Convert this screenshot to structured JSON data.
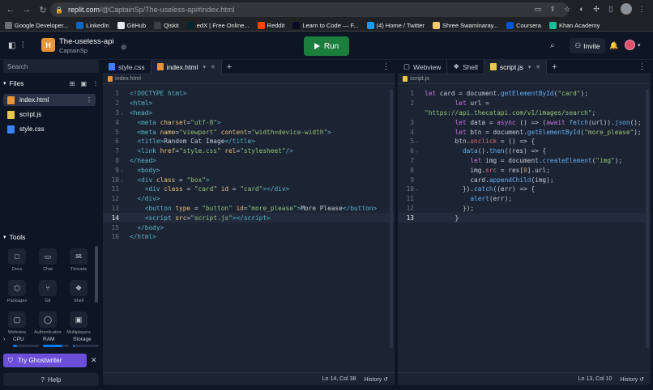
{
  "browser": {
    "url_host": "replit.com",
    "url_path": "/@CaptainSp/The-useless-api#index.html",
    "bookmarks": [
      {
        "label": "Google Developer...",
        "color": "#6d6f73"
      },
      {
        "label": "LinkedIn",
        "color": "#0a66c2"
      },
      {
        "label": "GitHub",
        "color": "#e8eaed"
      },
      {
        "label": "Qiskit",
        "color": "#3c4043"
      },
      {
        "label": "edX | Free Online...",
        "color": "#02262b"
      },
      {
        "label": "Reddit",
        "color": "#ff4500"
      },
      {
        "label": "Learn to Code — F...",
        "color": "#0a0a23"
      },
      {
        "label": "(4) Home / Twitter",
        "color": "#1d9bf0"
      },
      {
        "label": "Shree Swaminaray...",
        "color": "#f3c96b"
      },
      {
        "label": "Coursera",
        "color": "#0056d2"
      },
      {
        "label": "Khan Academy",
        "color": "#14bf96"
      }
    ]
  },
  "header": {
    "repl_name": "The-useless-api",
    "owner": "CaptainSp",
    "run_label": "Run",
    "invite_label": "Invite"
  },
  "sidebar": {
    "search_placeholder": "Search",
    "files_title": "Files",
    "files": [
      {
        "name": "index.html",
        "color": "#e9943a"
      },
      {
        "name": "script.js",
        "color": "#e9c74a"
      },
      {
        "name": "style.css",
        "color": "#3b82f6"
      }
    ],
    "tools_title": "Tools",
    "tools": [
      {
        "label": "Docs",
        "icon": "□"
      },
      {
        "label": "Chat",
        "icon": "▭"
      },
      {
        "label": "Threads",
        "icon": "✉"
      },
      {
        "label": "Packages",
        "icon": "⬡"
      },
      {
        "label": "Git",
        "icon": "⑂"
      },
      {
        "label": "Shell",
        "icon": "❖"
      },
      {
        "label": "Webview",
        "icon": "▢"
      },
      {
        "label": "Authentication",
        "icon": "◯"
      },
      {
        "label": "Multiplayers",
        "icon": "▣"
      }
    ],
    "resources": [
      {
        "label": "CPU",
        "fraction": 0.15
      },
      {
        "label": "RAM",
        "fraction": 0.75
      },
      {
        "label": "Storage",
        "fraction": 0.05
      }
    ],
    "ghost_label": "Try Ghostwriter",
    "help_label": "Help"
  },
  "left_pane": {
    "tabs": [
      "style.css",
      "index.html"
    ],
    "crumb": "index.html",
    "cursor": "Ln 14, Col 38",
    "history": "History",
    "lines": [
      "<span class=\"doc\">&lt;!DOCTYPE html&gt;</span>",
      "<span class=\"tag\">&lt;html&gt;</span>",
      "<span class=\"tag\">&lt;head&gt;</span>",
      "  <span class=\"tag\">&lt;meta</span> <span class=\"attr\">charset</span>=<span class=\"str\">\"utf-8\"</span><span class=\"tag\">&gt;</span>",
      "  <span class=\"tag\">&lt;meta</span> <span class=\"attr\">name</span>=<span class=\"str\">\"viewport\"</span> <span class=\"attr\">content</span>=<span class=\"str\">\"width=device-width\"</span><span class=\"tag\">&gt;</span>",
      "  <span class=\"tag\">&lt;title&gt;</span>Random Cat Image<span class=\"tag\">&lt;/title&gt;</span>",
      "  <span class=\"tag\">&lt;link</span> <span class=\"attr\">href</span>=<span class=\"str\">\"style.css\"</span> <span class=\"attr\">rel</span>=<span class=\"str\">\"stylesheet\"</span><span class=\"tag\">/&gt;</span>",
      "<span class=\"tag\">&lt;/head&gt;</span>",
      "  <span class=\"tag\">&lt;body&gt;</span>",
      "  <span class=\"tag\">&lt;div</span> <span class=\"attr\">class</span> = <span class=\"str\">\"box\"</span><span class=\"tag\">&gt;</span>",
      "    <span class=\"tag\">&lt;div</span> <span class=\"attr\">class</span> = <span class=\"str\">\"card\"</span> <span class=\"attr\">id</span> = <span class=\"str\">\"card\"</span><span class=\"tag\">&gt;&lt;/div&gt;</span>",
      "  <span class=\"tag\">&lt;/div&gt;</span>",
      "    <span class=\"tag\">&lt;button</span> <span class=\"attr\">type</span> = <span class=\"str\">\"button\"</span> <span class=\"attr\">id</span>=<span class=\"str\">\"more_please\"</span><span class=\"tag\">&gt;</span>More Please<span class=\"tag\">&lt;/button&gt;</span>",
      "    <span class=\"tag\">&lt;script</span> <span class=\"attr\">src</span>=<span class=\"str\">\"script.js\"</span><span class=\"tag\">&gt;&lt;/script&gt;</span>",
      "  <span class=\"tag\">&lt;/body&gt;</span>",
      "<span class=\"tag\">&lt;/html&gt;</span>"
    ],
    "current_line": 14
  },
  "right_pane": {
    "tabs": [
      "Webview",
      "Shell",
      "script.js"
    ],
    "crumb": "script.js",
    "cursor": "Ln 13, Col 10",
    "history": "History",
    "lines": [
      {
        "n": "1",
        "code": "<span class=\"kw\">let</span> card = document.<span class=\"fn\">getElementById</span>(<span class=\"str\">\"card\"</span>);"
      },
      {
        "n": "2",
        "code": "        <span class=\"kw\">let</span> url ="
      },
      {
        "n": "",
        "code": "<span class=\"str\">\"https://api.thecatapi.com/v1/images/search\"</span>;"
      },
      {
        "n": "3",
        "code": "        <span class=\"kw\">let</span> data = <span class=\"kw\">async</span> () =&gt; (<span class=\"kw\">await</span> <span class=\"fn\">fetch</span>(url)).<span class=\"fn\">json</span>();"
      },
      {
        "n": "4",
        "code": "        <span class=\"kw\">let</span> btn = document.<span class=\"fn\">getElementById</span>(<span class=\"str\">\"more_please\"</span>);"
      },
      {
        "n": "5",
        "code": "        btn.<span class=\"prop\">onclick</span> = () =&gt; {"
      },
      {
        "n": "6",
        "code": "          <span class=\"fn\">data</span>().<span class=\"fn\">then</span>((res) =&gt; {"
      },
      {
        "n": "7",
        "code": "            <span class=\"kw\">let</span> img = document.<span class=\"fn\">createElement</span>(<span class=\"str\">\"img\"</span>);"
      },
      {
        "n": "8",
        "code": "            img.<span class=\"prop\">src</span> = res[<span class=\"num\">0</span>].url;"
      },
      {
        "n": "9",
        "code": "            card.<span class=\"fn\">appendChild</span>(img);"
      },
      {
        "n": "10",
        "code": "          }).<span class=\"fn\">catch</span>((err) =&gt; {"
      },
      {
        "n": "11",
        "code": "            <span class=\"fn\">alert</span>(err);"
      },
      {
        "n": "12",
        "code": "          });"
      },
      {
        "n": "13",
        "code": "        }"
      }
    ],
    "current_line": "13"
  }
}
